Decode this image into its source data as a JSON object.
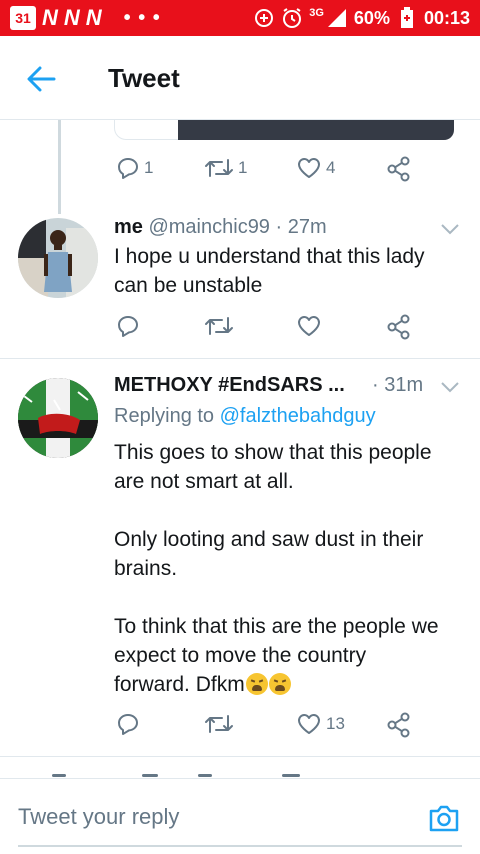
{
  "status_bar": {
    "calendar_day": "31",
    "app_logos": [
      "N",
      "N",
      "N"
    ],
    "more": "• • •",
    "network": "3G",
    "battery": "60%",
    "time": "00:13"
  },
  "header": {
    "title": "Tweet",
    "back_icon": "arrow-left-icon"
  },
  "previous_tweet": {
    "actions": {
      "reply_count": "1",
      "retweet_count": "1",
      "like_count": "4"
    }
  },
  "tweets": [
    {
      "name": "me",
      "handle": "@mainchic99",
      "separator": "·",
      "time": "27m",
      "text_lines": [
        "I hope u understand that this lady",
        "can be unstable"
      ],
      "actions": {
        "reply_count": "",
        "retweet_count": "",
        "like_count": ""
      }
    },
    {
      "name": "METHOXY #EndSARS ...",
      "handle": "",
      "separator": "·",
      "time": "31m",
      "replying_prefix": "Replying to",
      "replying_to": "@falzthebahdguy",
      "paragraphs": [
        [
          "This goes to show that this people",
          "are not smart at all."
        ],
        [
          "Only looting and saw dust in their",
          "brains."
        ],
        [
          "To think that this are the people we",
          "expect to move the country",
          "forward. Dfkm"
        ]
      ],
      "actions": {
        "reply_count": "",
        "retweet_count": "",
        "like_count": "13"
      }
    }
  ],
  "reply_bar": {
    "placeholder": "Tweet your reply",
    "camera_icon": "camera-icon"
  },
  "colors": {
    "status_bar": "#e8101b",
    "accent": "#1da1f2",
    "secondary_text": "#657786",
    "divider": "#e1e8ed"
  }
}
